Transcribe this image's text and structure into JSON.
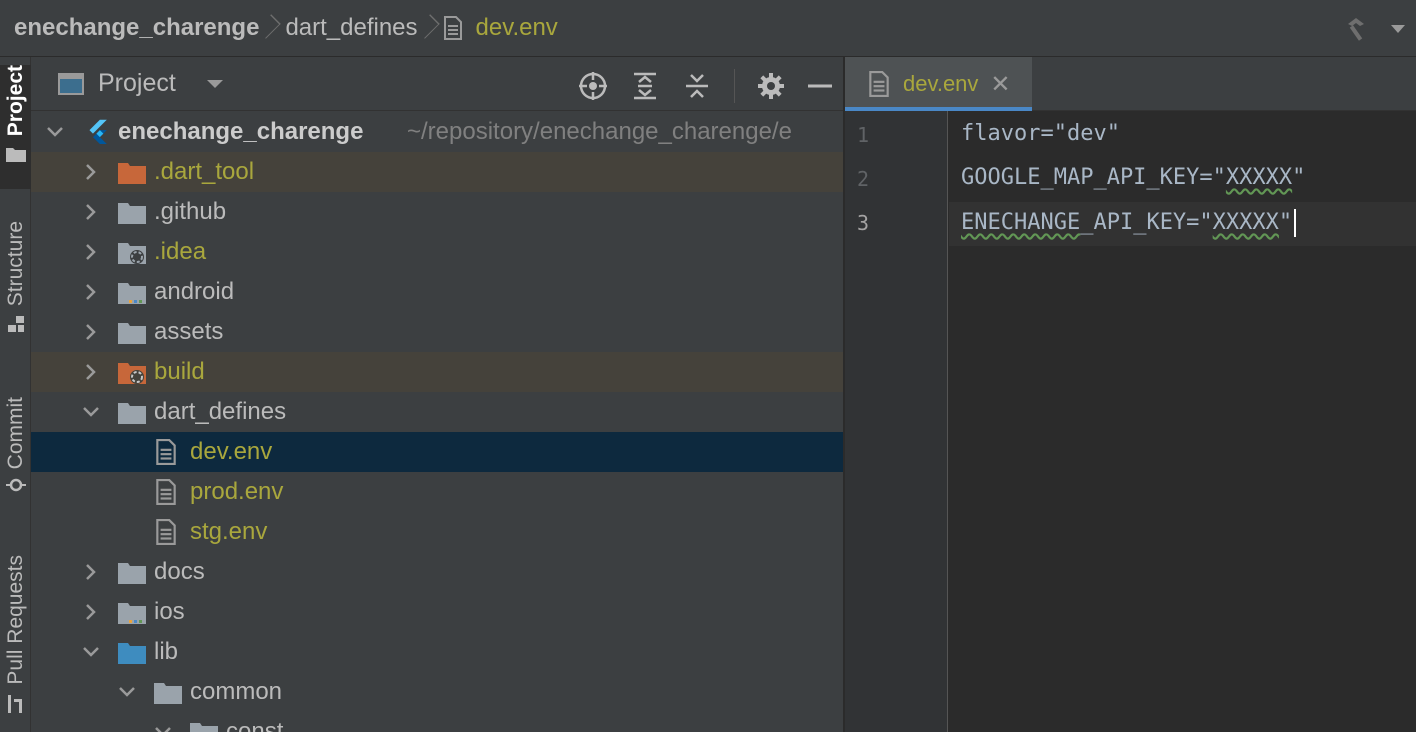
{
  "breadcrumb": {
    "project": "enechange_charenge",
    "folder": "dart_defines",
    "file": "dev.env"
  },
  "toolstrip": {
    "tabs": [
      "Project",
      "Structure",
      "Commit",
      "Pull Requests"
    ]
  },
  "project_panel": {
    "title": "Project",
    "root": {
      "name": "enechange_charenge",
      "path": "~/repository/enechange_charenge/e"
    },
    "items": [
      {
        "label": ".dart_tool"
      },
      {
        "label": ".github"
      },
      {
        "label": ".idea"
      },
      {
        "label": "android"
      },
      {
        "label": "assets"
      },
      {
        "label": "build"
      },
      {
        "label": "dart_defines"
      },
      {
        "label": "dev.env"
      },
      {
        "label": "prod.env"
      },
      {
        "label": "stg.env"
      },
      {
        "label": "docs"
      },
      {
        "label": "ios"
      },
      {
        "label": "lib"
      },
      {
        "label": "common"
      },
      {
        "label": "const"
      }
    ]
  },
  "editor": {
    "tab_label": "dev.env",
    "lines": [
      {
        "number": "1",
        "text": "flavor=\"dev\""
      },
      {
        "number": "2",
        "prefix": "GOOGLE_MAP_API_KEY=\"",
        "word": "XXXXX",
        "suffix": "\""
      },
      {
        "number": "3",
        "word1": "ENECHANGE",
        "middle": "_API_KEY=\"",
        "word2": "XXXXX",
        "suffix": "\""
      }
    ]
  },
  "colors": {
    "background": "#2b2b2b",
    "panel": "#3c3f41",
    "selection": "#0d293e",
    "excluded": "#45423b",
    "modified_file": "#a9a73d",
    "tab_underline": "#4a88c7"
  }
}
